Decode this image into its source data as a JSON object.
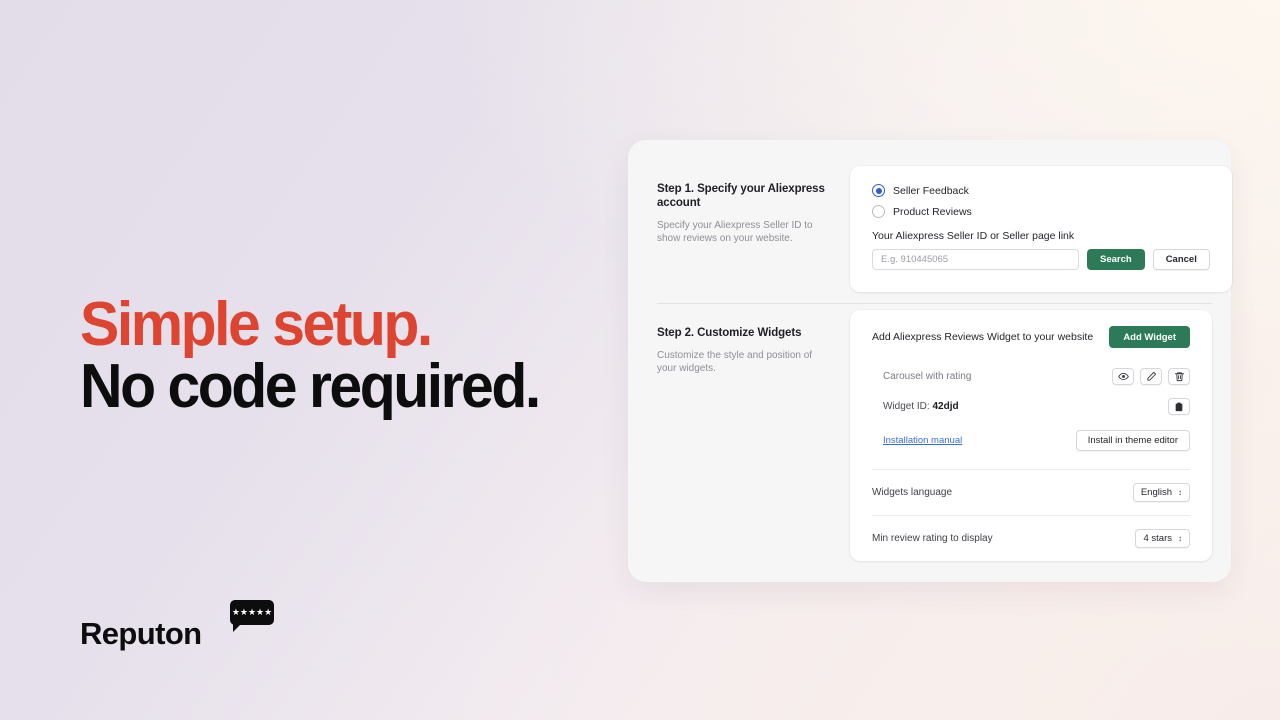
{
  "promo": {
    "line1": "Simple setup.",
    "line2": "No code required.",
    "line1_color": "#dd4531",
    "line2_color": "#0d0d0d"
  },
  "logo": {
    "word": "Reputon",
    "stars": "★★★★★",
    "bubble_color": "#0d0d0d"
  },
  "app": {
    "accent_green": "#2d7a58",
    "link_blue": "#3b6ddb",
    "radio_blue": "#2b5cd9",
    "step1": {
      "title": "Step 1. Specify your Aliexpress account",
      "subtitle": "Specify your Aliexpress Seller ID to show reviews on your website.",
      "radios": [
        {
          "label": "Seller Feedback",
          "checked": true
        },
        {
          "label": "Product Reviews",
          "checked": false
        }
      ],
      "field_label": "Your Aliexpress Seller ID or Seller page link",
      "input_value": "",
      "input_placeholder": "E.g. 910445065",
      "search_label": "Search",
      "cancel_label": "Cancel"
    },
    "step2": {
      "title": "Step 2. Customize Widgets",
      "subtitle": "Customize the style and position of your widgets.",
      "heading": "Add Aliexpress Reviews Widget to your website",
      "add_widget_label": "Add Widget",
      "widget_name": "Carousel with rating",
      "widget_id_label": "Widget ID:",
      "widget_id_value": "42djd",
      "installation_manual_label": "Installation manual",
      "install_theme_editor_label": "Install in theme editor",
      "settings": [
        {
          "label": "Widgets language",
          "value": "English"
        },
        {
          "label": "Min review rating to display",
          "value": "4 stars"
        }
      ],
      "icons": {
        "preview": "eye-icon",
        "edit": "pencil-icon",
        "delete": "trash-icon",
        "copy": "clipboard-icon"
      }
    }
  }
}
